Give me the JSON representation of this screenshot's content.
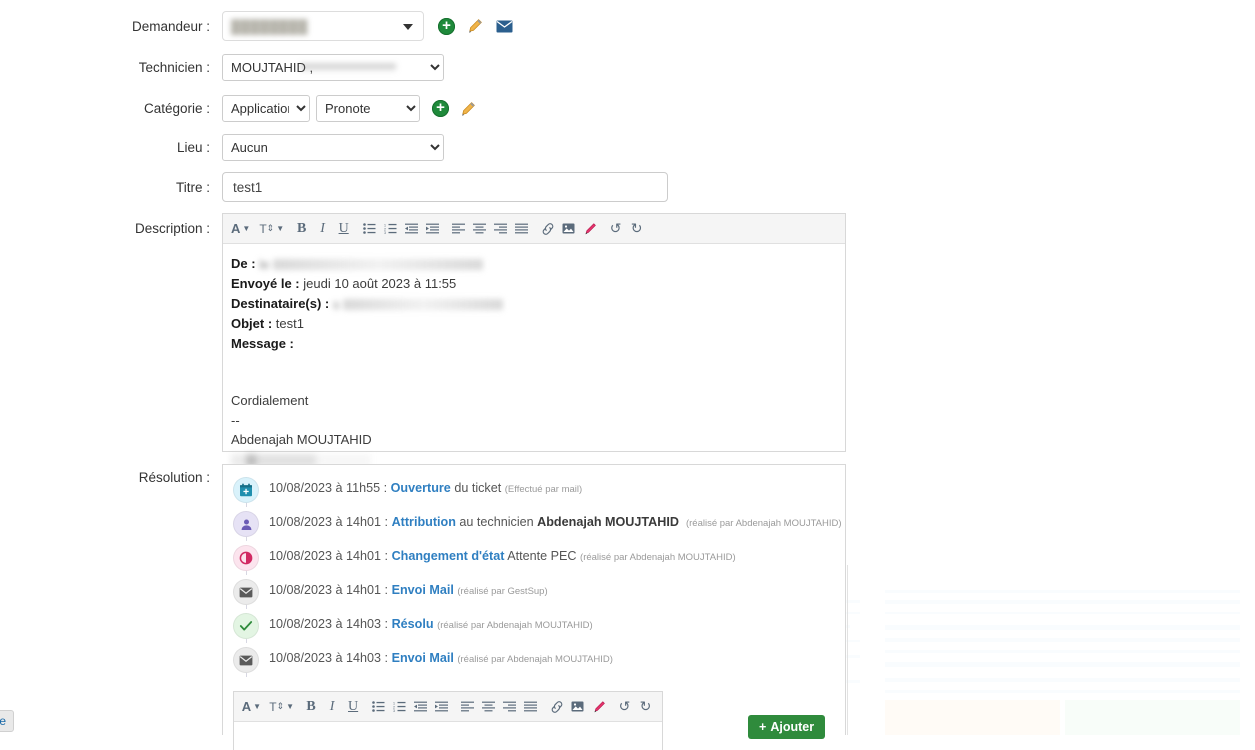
{
  "form": {
    "fields": {
      "demandeur_label": "Demandeur :",
      "demandeur_value": "████████",
      "technicien_label": "Technicien :",
      "technicien_value": "MOUJTAHID Abdenajah",
      "technicien_visible": "MOUJTAHID ,",
      "categorie_label": "Catégorie :",
      "categorie_value": "Application",
      "souscategorie_value": "Pronote",
      "lieu_label": "Lieu :",
      "lieu_value": "Aucun",
      "titre_label": "Titre :",
      "titre_value": "test1",
      "description_label": "Description :",
      "resolution_label": "Résolution :"
    },
    "actions": {
      "add_demandeur": "+",
      "edit_demandeur": "pencil-icon",
      "mail_demandeur": "envelope-icon",
      "add_categorie": "+",
      "edit_categorie": "pencil-icon"
    }
  },
  "editor_toolbar": {
    "items": [
      {
        "name": "font-color-icon",
        "glyph": "A",
        "chevron": true
      },
      {
        "name": "font-size-icon",
        "glyph": "T↕",
        "chevron": true
      },
      {
        "name": "bold-icon",
        "glyph": "B"
      },
      {
        "name": "italic-icon",
        "glyph": "I"
      },
      {
        "name": "underline-icon",
        "glyph": "U"
      },
      {
        "name": "bullet-list-icon",
        "glyph": "list-ul"
      },
      {
        "name": "numbered-list-icon",
        "glyph": "list-ol"
      },
      {
        "name": "outdent-icon",
        "glyph": "outdent"
      },
      {
        "name": "indent-icon",
        "glyph": "indent"
      },
      {
        "name": "align-left-icon",
        "glyph": "align-left"
      },
      {
        "name": "align-center-icon",
        "glyph": "align-center"
      },
      {
        "name": "align-right-icon",
        "glyph": "align-right"
      },
      {
        "name": "align-justify-icon",
        "glyph": "align-justify"
      },
      {
        "name": "link-icon",
        "glyph": "link"
      },
      {
        "name": "image-icon",
        "glyph": "image"
      },
      {
        "name": "highlighter-icon",
        "glyph": "marker"
      },
      {
        "name": "undo-icon",
        "glyph": "↺"
      },
      {
        "name": "redo-icon",
        "glyph": "↻"
      }
    ]
  },
  "description": {
    "de_label": "De :",
    "de_value": "le",
    "envoye_label": "Envoyé le :",
    "envoye_value": "jeudi 10 août 2023 à 11:55",
    "destinataire_label": "Destinataire(s) :",
    "destinataire_value": "s",
    "objet_label": "Objet :",
    "objet_value": "test1",
    "message_label": "Message :",
    "salutation": "Cordialement",
    "separator": "--",
    "signature": "Abdenajah MOUJTAHID"
  },
  "resolution": {
    "events": [
      {
        "icon": "calendar-plus-icon",
        "icon_bg": "#d9f2fb",
        "icon_color": "#1f8fae",
        "date": "10/08/2023 à 11h55 : ",
        "action": "Ouverture",
        "detail": " du ticket ",
        "meta": "(Effectué par mail)",
        "who": ""
      },
      {
        "icon": "user-icon",
        "icon_bg": "#e6e2f5",
        "icon_color": "#6b5bb5",
        "date": "10/08/2023 à 14h01 : ",
        "action": "Attribution",
        "detail": " au technicien ",
        "who": "Abdenajah MOUJTAHID",
        "meta": "(réalisé par Abdenajah MOUJTAHID)"
      },
      {
        "icon": "contrast-icon",
        "icon_bg": "#fce4ee",
        "icon_color": "#d12a63",
        "date": "10/08/2023 à 14h01 : ",
        "action": "Changement d'état",
        "detail": " Attente PEC ",
        "who": "",
        "meta": "(réalisé par Abdenajah MOUJTAHID)"
      },
      {
        "icon": "envelope-icon",
        "icon_bg": "#ebebeb",
        "icon_color": "#5a5a5a",
        "date": "10/08/2023 à 14h01 : ",
        "action": "Envoi Mail",
        "detail": " ",
        "who": "",
        "meta": "(réalisé par GestSup)"
      },
      {
        "icon": "check-icon",
        "icon_bg": "#e3f5e3",
        "icon_color": "#2f8b3c",
        "date": "10/08/2023 à 14h03 : ",
        "action": "Résolu",
        "detail": " ",
        "who": "",
        "meta": "(réalisé par Abdenajah MOUJTAHID)"
      },
      {
        "icon": "envelope-icon",
        "icon_bg": "#ebebeb",
        "icon_color": "#5a5a5a",
        "date": "10/08/2023 à 14h03 : ",
        "action": "Envoi Mail",
        "detail": " ",
        "who": "",
        "meta": "(réalisé par Abdenajah MOUJTAHID)"
      }
    ],
    "add_button": "Ajouter",
    "add_button_plus": "+"
  },
  "corner": {
    "tab_label": "lure"
  },
  "colors": {
    "accent_link": "#2f7fc1",
    "success": "#2f8b3c",
    "pencil": "#e8a33d",
    "mail": "#2b5f8e",
    "highlighter": "#e8336d"
  }
}
